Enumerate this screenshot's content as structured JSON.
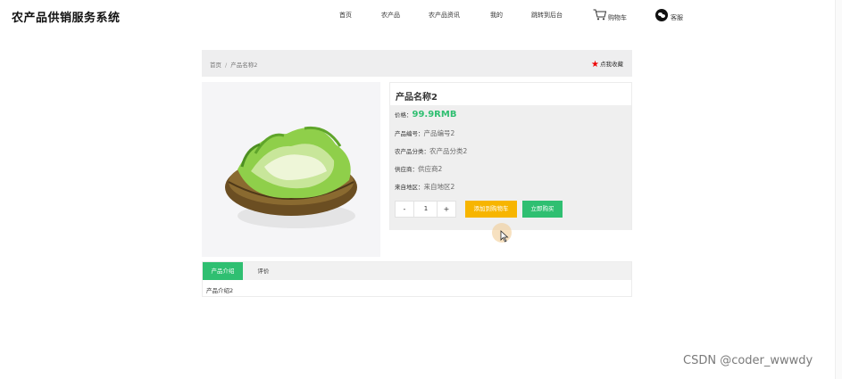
{
  "site": {
    "title": "农产品供销服务系统"
  },
  "nav": {
    "items": [
      "首页",
      "农产品",
      "农产品资讯",
      "我的",
      "跳转到后台",
      "购物车",
      "客服"
    ]
  },
  "breadcrumb": {
    "home": "首页",
    "separator": "/",
    "current": "产品名称2"
  },
  "favorite": {
    "label": "点我收藏"
  },
  "product": {
    "name": "产品名称2",
    "price_label": "价格：",
    "price": "99.9RMB",
    "code_label": "产品编号：",
    "code": "产品编号2",
    "category_label": "农产品分类：",
    "category": "农产品分类2",
    "supplier_label": "供应商：",
    "supplier": "供应商2",
    "origin_label": "来自地区：",
    "origin": "来自地区2",
    "quantity": "1",
    "minus": "-",
    "plus": "+",
    "add_to_cart": "添加到购物车",
    "buy_now": "立即购买",
    "image_icon": "lettuce-basket-image"
  },
  "tabs": {
    "intro": "产品介绍",
    "reviews": "评价",
    "content": "产品介绍2"
  },
  "watermark": "CSDN @coder_wwwdy",
  "colors": {
    "accent_green": "#2fbf71",
    "cart_orange": "#f7b500",
    "star_red": "#e00000"
  }
}
